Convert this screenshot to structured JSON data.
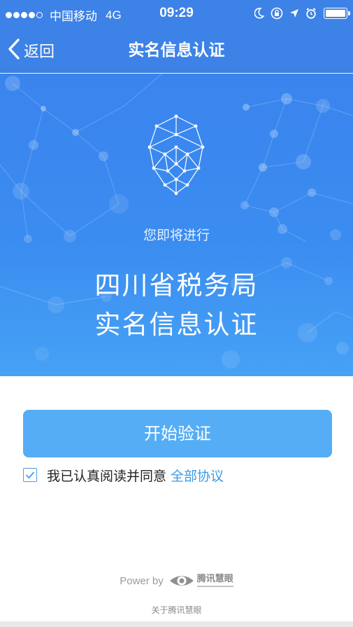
{
  "status_bar": {
    "carrier": "中国移动",
    "network": "4G",
    "time": "09:29",
    "signal_bars_filled": 4,
    "signal_bars_total": 5,
    "icons": [
      "moon-icon",
      "rotation-lock-icon",
      "location-arrow-icon",
      "alarm-icon",
      "battery-icon"
    ],
    "battery_level": 1.0
  },
  "nav": {
    "back_label": "返回",
    "title": "实名信息认证"
  },
  "hero": {
    "icon": "face-mesh-icon",
    "subtitle": "您即将进行",
    "line1": "四川省税务局",
    "line2": "实名信息认证"
  },
  "actions": {
    "start_button": "开始验证",
    "agree_checked": true,
    "agree_text": "我已认真阅读并同意",
    "agreement_link": "全部协议"
  },
  "footer": {
    "power_by": "Power by",
    "brand_name": "腾讯慧眼",
    "about_link": "关于腾讯慧眼"
  },
  "colors": {
    "header_blue": "#3d82e6",
    "button_blue": "#55adf5",
    "link_blue": "#3a9ae6"
  }
}
